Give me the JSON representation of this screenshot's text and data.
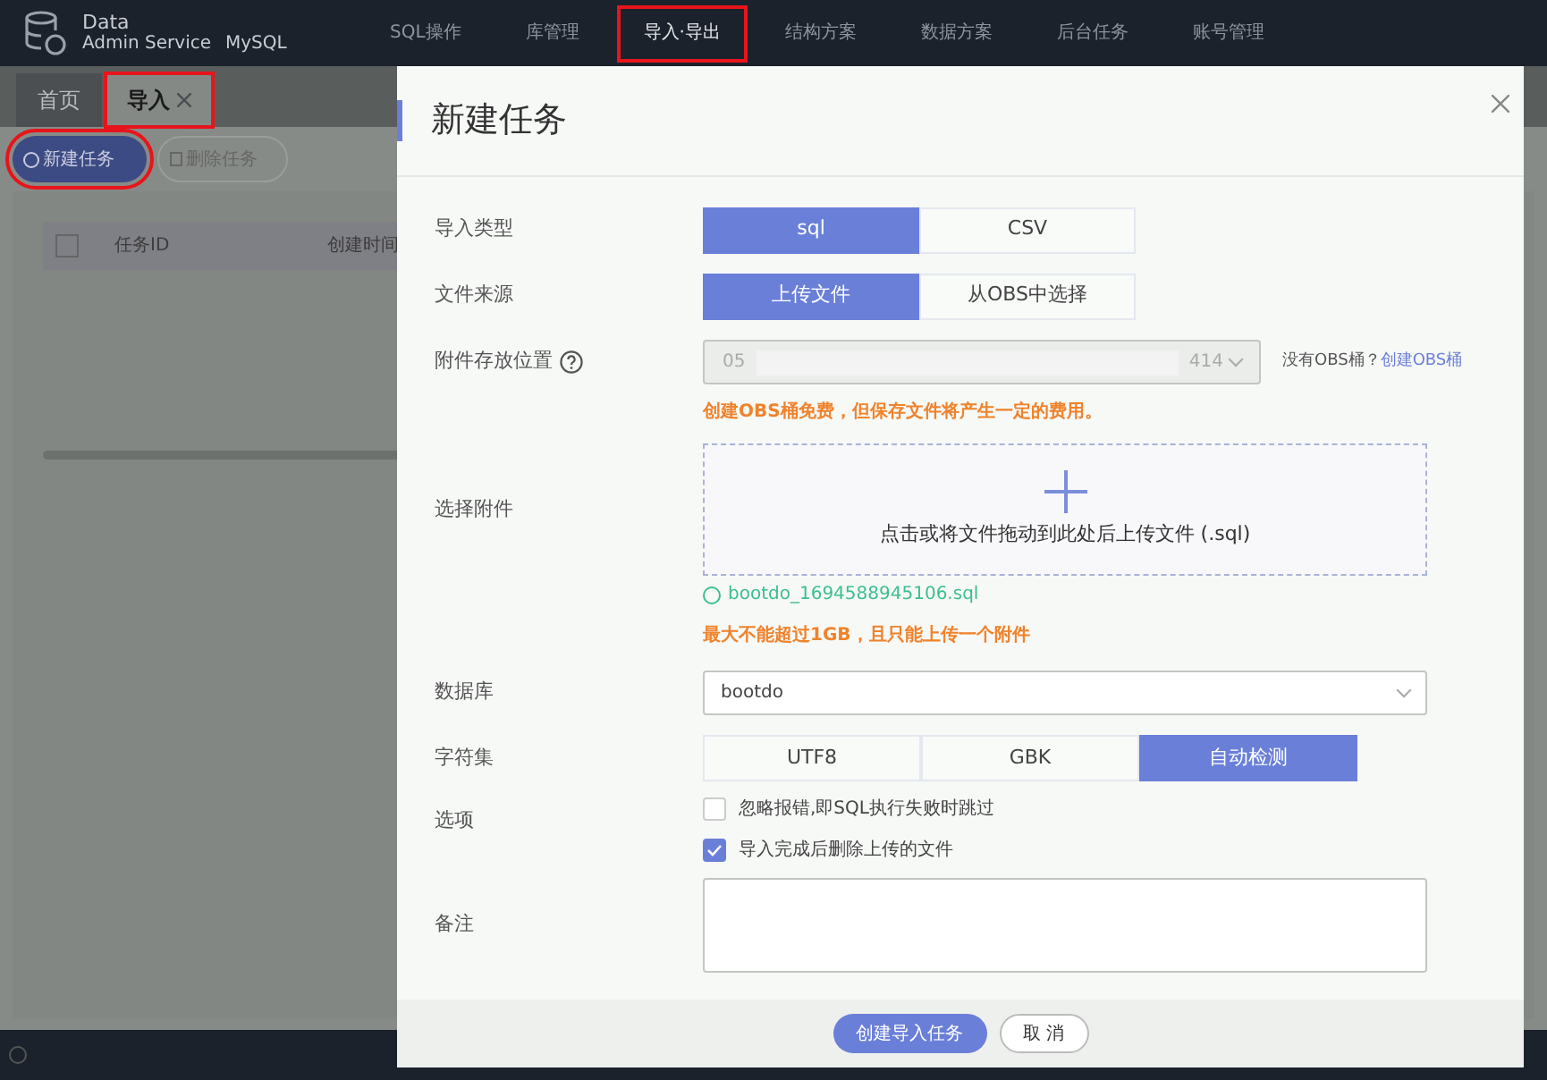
{
  "logo": {
    "title": "Data",
    "subtitle": "Admin Service",
    "engine": "MySQL"
  },
  "nav": [
    {
      "label": "SQL操作",
      "selected": false,
      "highlighted": false
    },
    {
      "label": "库管理",
      "selected": false,
      "highlighted": false
    },
    {
      "label": "导入·导出",
      "selected": true,
      "highlighted": true
    },
    {
      "label": "结构方案",
      "selected": false,
      "highlighted": false
    },
    {
      "label": "数据方案",
      "selected": false,
      "highlighted": false
    },
    {
      "label": "后台任务",
      "selected": false,
      "highlighted": false
    },
    {
      "label": "账号管理",
      "selected": false,
      "highlighted": false
    }
  ],
  "tabs": [
    {
      "label": "首页",
      "selected": false,
      "highlighted": false,
      "closable": false
    },
    {
      "label": "导入",
      "selected": true,
      "highlighted": true,
      "closable": true
    }
  ],
  "toolbar": [
    {
      "label": "新建任务",
      "kind": "primary",
      "highlighted": true
    },
    {
      "label": "删除任务",
      "kind": "outline",
      "highlighted": false
    }
  ],
  "table": {
    "all_checked": false,
    "columns": [
      "任务ID",
      "创建时间"
    ]
  },
  "dialog": {
    "title": "新建任务",
    "import_type": {
      "label": "导入类型",
      "options": [
        {
          "label": "sql",
          "selected": true
        },
        {
          "label": "CSV",
          "selected": false
        }
      ]
    },
    "file_source": {
      "label": "文件来源",
      "options": [
        {
          "label": "上传文件",
          "selected": true
        },
        {
          "label": "从OBS中选择",
          "selected": false
        }
      ]
    },
    "storage": {
      "label": "附件存放位置",
      "value_start": "05",
      "value_end": "414",
      "disabled": true,
      "hint": "没有OBS桶？",
      "link": "创建OBS桶",
      "warning": "创建OBS桶免费，但保存文件将产生一定的费用。"
    },
    "attachment": {
      "label": "选择附件",
      "drop_text": "点击或将文件拖动到此处后上传文件 (.sql)",
      "file": "bootdo_1694588945106.sql",
      "warning": "最大不能超过1GB，且只能上传一个附件"
    },
    "database": {
      "label": "数据库",
      "value": "bootdo"
    },
    "charset": {
      "label": "字符集",
      "options": [
        {
          "label": "UTF8",
          "selected": false
        },
        {
          "label": "GBK",
          "selected": false
        },
        {
          "label": "自动检测",
          "selected": true
        }
      ]
    },
    "options": {
      "label": "选项",
      "items": [
        {
          "label": "忽略报错,即SQL执行失败时跳过",
          "checked": false
        },
        {
          "label": "导入完成后删除上传的文件",
          "checked": true
        }
      ]
    },
    "notes": {
      "label": "备注"
    },
    "buttons": [
      {
        "label": "创建导入任务",
        "kind": "primary"
      },
      {
        "label": "取 消",
        "kind": "secondary"
      }
    ]
  }
}
